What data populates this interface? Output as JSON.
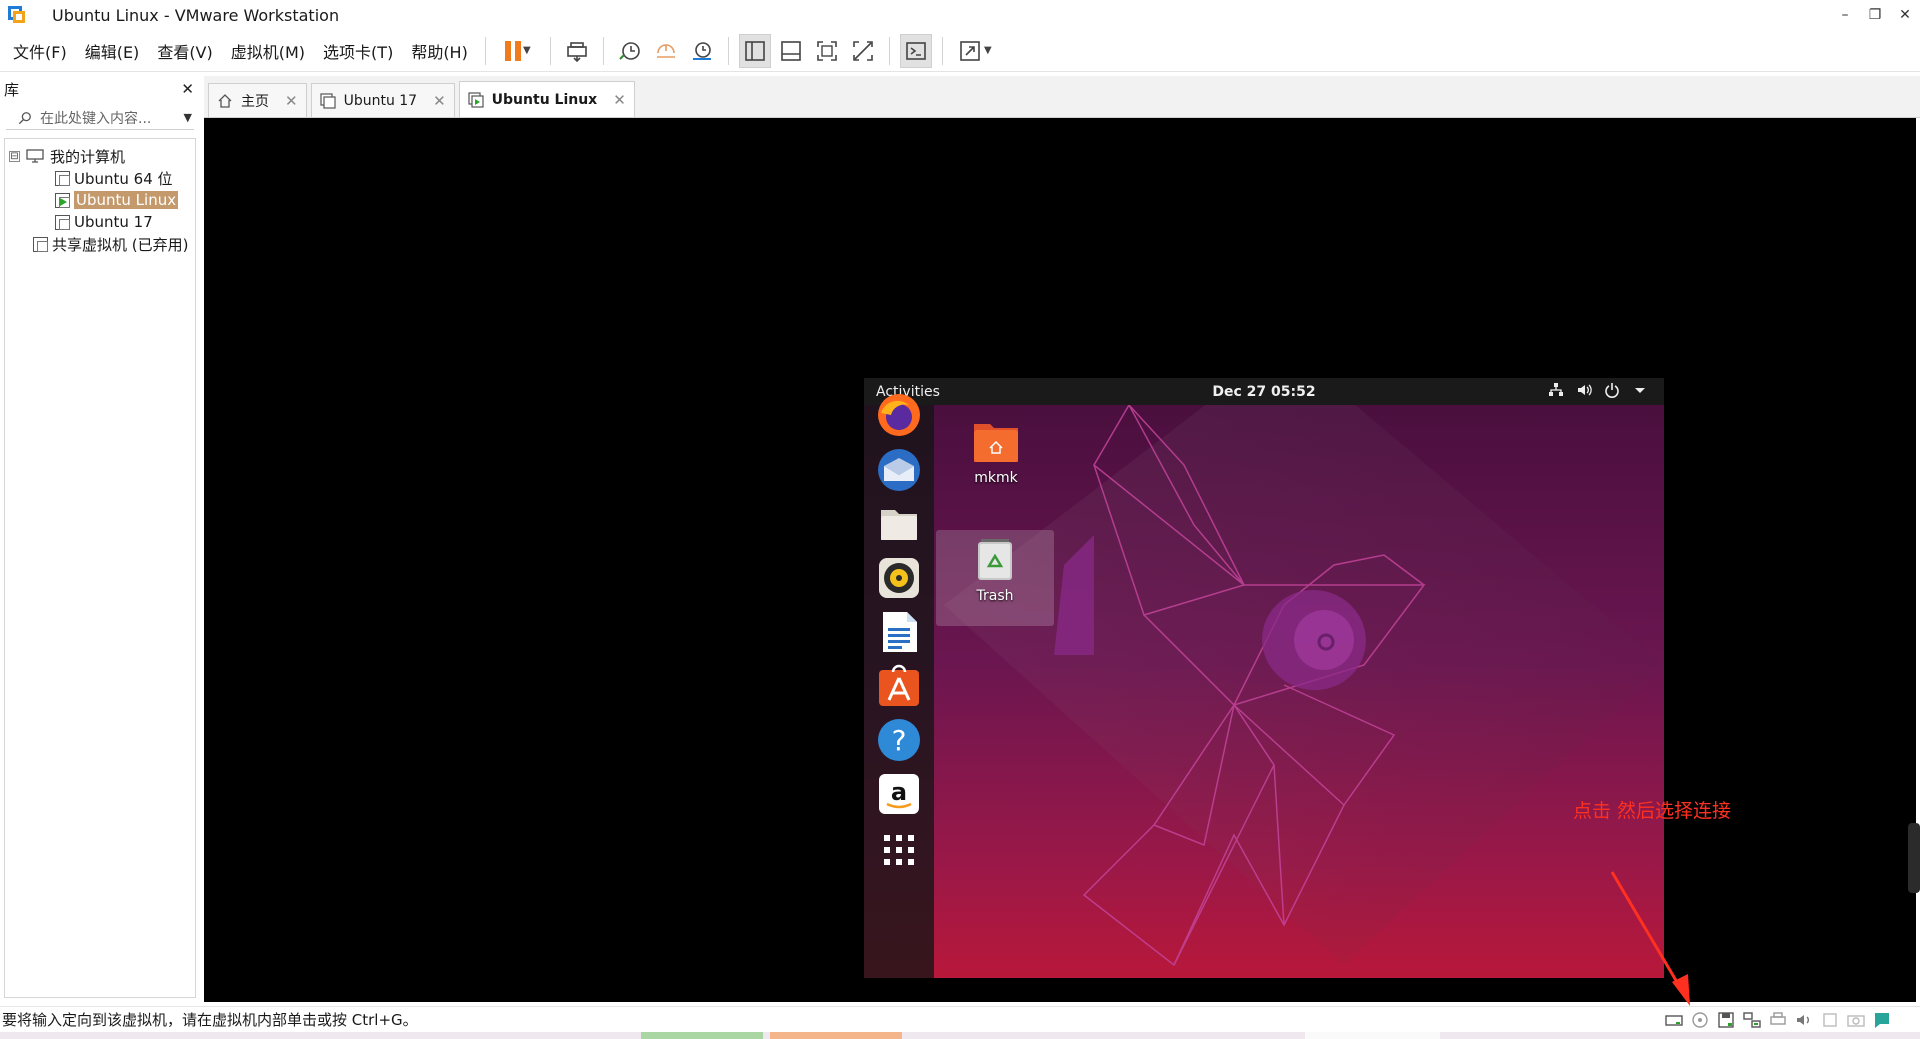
{
  "window": {
    "title": "Ubuntu Linux - VMware Workstation",
    "minimize_label": "–",
    "restore_label": "❐",
    "close_label": "✕"
  },
  "menu": {
    "items": [
      "文件(F)",
      "编辑(E)",
      "查看(V)",
      "虚拟机(M)",
      "选项卡(T)",
      "帮助(H)"
    ]
  },
  "toolbar": {
    "icons": [
      "pause-icon",
      "send-keys-icon",
      "snapshot-icon",
      "revert-snapshot-icon",
      "manage-snapshots-icon",
      "show-library-icon",
      "thumbnail-bar-icon",
      "full-screen-icon",
      "unity-icon",
      "console-icon",
      "stretch-icon"
    ],
    "accent_pause": "#f07b1d"
  },
  "library": {
    "title": "库",
    "close_label": "✕",
    "search_placeholder": "在此处键入内容...",
    "tree": {
      "root": "我的计算机",
      "expander": "⊟",
      "vms": [
        {
          "name": "Ubuntu 64 位",
          "running": false,
          "selected": false
        },
        {
          "name": "Ubuntu Linux",
          "running": true,
          "selected": true
        },
        {
          "name": "Ubuntu 17",
          "running": false,
          "selected": false
        }
      ],
      "shared": "共享虚拟机 (已弃用)"
    }
  },
  "tabs": [
    {
      "label": "主页",
      "icon": "home-icon",
      "active": false
    },
    {
      "label": "Ubuntu 17",
      "icon": "vm-icon",
      "active": false
    },
    {
      "label": "Ubuntu Linux",
      "icon": "vm-running-icon",
      "active": true
    }
  ],
  "tab_close_label": "✕",
  "guest": {
    "activities": "Activities",
    "clock": "Dec 27  05:52",
    "tray_icons": [
      "network-icon",
      "volume-icon",
      "power-icon",
      "chevron-down-icon"
    ],
    "dock_apps": [
      "firefox-icon",
      "thunderbird-icon",
      "files-icon",
      "rhythmbox-icon",
      "libreoffice-writer-icon",
      "software-center-icon",
      "help-icon",
      "amazon-icon",
      "show-apps-icon"
    ],
    "desktop_icons": [
      {
        "label": "mkmk",
        "icon": "home-folder-icon"
      },
      {
        "label": "Trash",
        "icon": "trash-icon"
      }
    ]
  },
  "annotation": {
    "text": "点击 然后选择连接",
    "color": "#ff3020"
  },
  "status": {
    "text": "要将输入定向到该虚拟机，请在虚拟机内部单击或按 Ctrl+G。",
    "icons": [
      "hard-disk-icon",
      "cd-dvd-icon",
      "floppy-icon",
      "network-adapter-icon",
      "usb-printer-icon",
      "sound-icon",
      "display-icon",
      "camera-icon",
      "message-icon"
    ]
  }
}
